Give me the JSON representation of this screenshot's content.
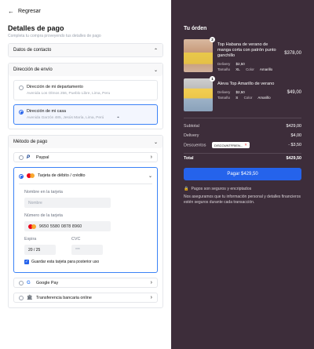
{
  "header": {
    "back_label": "Regresar"
  },
  "checkout": {
    "title": "Detalles de pago",
    "subtitle": "Completa tu compra proveyendo tus detalles de pago"
  },
  "contact": {
    "label": "Datos de contacto"
  },
  "shipping": {
    "label": "Dirección de envío",
    "addresses": [
      {
        "title": "Dirección de mi departamento",
        "detail": "Avenida Los Olmos 256, Pueblo Libre, Lima, Peru",
        "selected": false
      },
      {
        "title": "Dirección de mi casa",
        "detail": "Avenida Garzón 485, Jesús María, Lima, Perú",
        "selected": true
      }
    ]
  },
  "payment": {
    "label": "Método de pago",
    "paypal_label": "Paypal",
    "card_label": "Tarjeta de débito / crédito",
    "card_fields": {
      "name_label": "Nombre en la tarjeta",
      "name_placeholder": "Nombre",
      "number_label": "Número de la tarjeta",
      "number_value": "9650  5580  0878  8960",
      "expiry_label": "Expira",
      "expiry_value": "20  /  25",
      "cvc_label": "CVC",
      "cvc_placeholder": "***",
      "save_label": "Guardar esta tarjeta para posterior uso"
    },
    "gpay_label": "Google Pay",
    "bank_label": "Transferencia bancaria online"
  },
  "order": {
    "title": "Tu órden",
    "items": [
      {
        "qty": "2",
        "name": "Top Habana de verano de manga corta con patrón punto ganchillo",
        "delivery_label": "Delivery",
        "delivery": "$2,50",
        "size_label": "Tamaño",
        "size": "XL",
        "color_label": "Color",
        "color": "Amarillo",
        "price": "$378,00"
      },
      {
        "qty": "1",
        "name": "Aleva Top Amarillo de verano",
        "delivery_label": "Delivery",
        "delivery": "$2,50",
        "size_label": "Tamaño",
        "size": "S",
        "color_label": "Color",
        "color": "Amarillo",
        "price": "$49,00"
      }
    ],
    "summary": {
      "subtotal_label": "Subtotal",
      "subtotal": "$429,00",
      "delivery_label": "Delivery",
      "delivery": "$4,00",
      "discount_label": "Descuentos",
      "discount_code": "DISCOUNTFRIEN...",
      "discount": "- $3,50",
      "total_label": "Total",
      "total": "$429,50"
    },
    "pay_button": "Pagar $429,50",
    "secure_label": "Pagos son seguros y encriptados",
    "note": "Nos aseguramos que tu información personal y detalles financieros estén seguros durante cada transacción."
  },
  "colors": {
    "accent": "#2563eb",
    "panel": "#3d2d3a"
  }
}
